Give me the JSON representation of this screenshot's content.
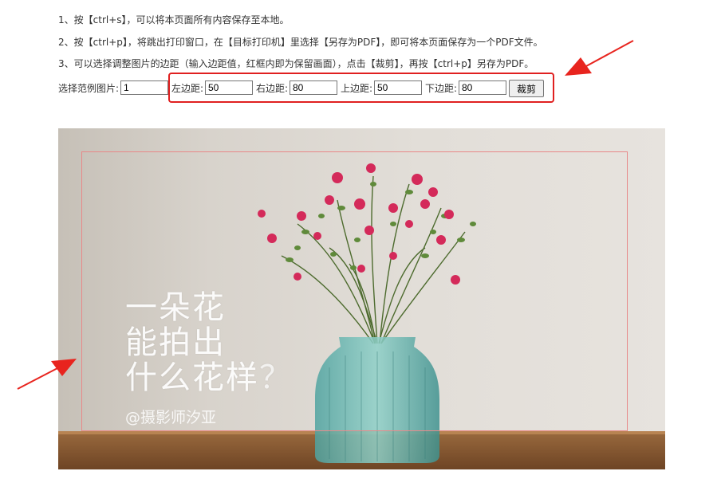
{
  "instructions": [
    "1、按【ctrl+s】，可以将本页面所有内容保存至本地。",
    "2、按【ctrl+p】，将跳出打印窗口，在【目标打印机】里选择【另存为PDF】，即可将本页面保存为一个PDF文件。",
    "3、可以选择调整图片的边距（输入边距值，红框内即为保留画面），点击【裁剪】，再按【ctrl+p】另存为PDF。"
  ],
  "controls": {
    "example_label": "选择范例图片:",
    "example_value": "1",
    "left_label": "左边距:",
    "left_value": "50",
    "right_label": "右边距:",
    "right_value": "80",
    "top_label": "上边距:",
    "top_value": "50",
    "bottom_label": "下边距:",
    "bottom_value": "80",
    "crop_button": "裁剪"
  },
  "photo": {
    "title_lines": [
      "一朵花",
      "能拍出",
      "什么花样"
    ],
    "title_question": "？",
    "watermark": "@摄影师汐亚"
  },
  "colors": {
    "highlight": "#e02020",
    "crop_frame": "#e88888",
    "arrow": "#e8241e"
  }
}
